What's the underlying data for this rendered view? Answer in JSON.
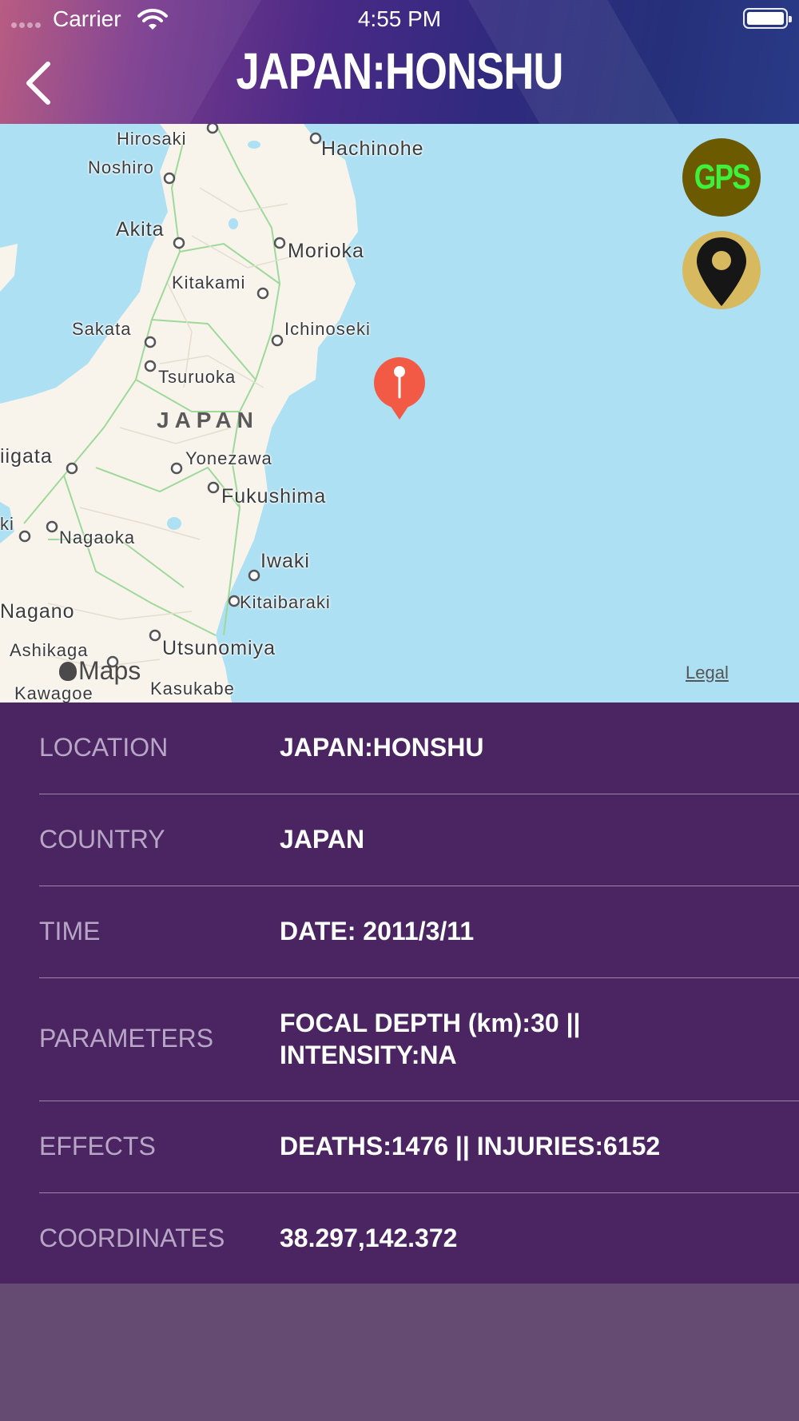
{
  "status_bar": {
    "carrier": "Carrier",
    "time": "4:55 PM"
  },
  "header": {
    "title": "JAPAN:HONSHU",
    "back_icon": "chevron-left-icon"
  },
  "map": {
    "places": {
      "hirosaki": "Hirosaki",
      "hachinohe": "Hachinohe",
      "noshiro": "Noshiro",
      "akita": "Akita",
      "morioka": "Morioka",
      "kitakami": "Kitakami",
      "sakata": "Sakata",
      "ichinoseki": "Ichinoseki",
      "tsuruoka": "Tsuruoka",
      "japan": "JAPAN",
      "niigata": "iigata",
      "yonezawa": "Yonezawa",
      "fukushima": "Fukushima",
      "ki": "ki",
      "nagaoka": "Nagaoka",
      "iwaki": "Iwaki",
      "kitaibaraki": "Kitaibaraki",
      "nagano": "Nagano",
      "ashikaga": "Ashikaga",
      "utsunomiya": "Utsunomiya",
      "kawagoe": "Kawagoe",
      "kasukabe": "Kasukabe"
    },
    "maps_logo": "Maps",
    "legal": "Legal",
    "gps_label": "GPS",
    "location_icon": "location-pin-icon",
    "marker_icon": "map-marker-icon",
    "colors": {
      "water": "#ade0f3",
      "land": "#f8f4ec",
      "marker": "#f25a45"
    }
  },
  "details": {
    "rows": [
      {
        "label": "LOCATION",
        "value": "JAPAN:HONSHU"
      },
      {
        "label": "COUNTRY",
        "value": "JAPAN"
      },
      {
        "label": "TIME",
        "value": "DATE: 2011/3/11"
      },
      {
        "label": "PARAMETERS",
        "value": "FOCAL DEPTH (km):30  ||",
        "value2": "INTENSITY:NA"
      },
      {
        "label": "EFFECTS",
        "value": "DEATHS:1476  ||  INJURIES:6152"
      },
      {
        "label": "COORDINATES",
        "value": "38.297,142.372"
      }
    ]
  },
  "colors": {
    "panel": "#4a2562",
    "background": "#654a72",
    "label": "#b8a6c6"
  }
}
